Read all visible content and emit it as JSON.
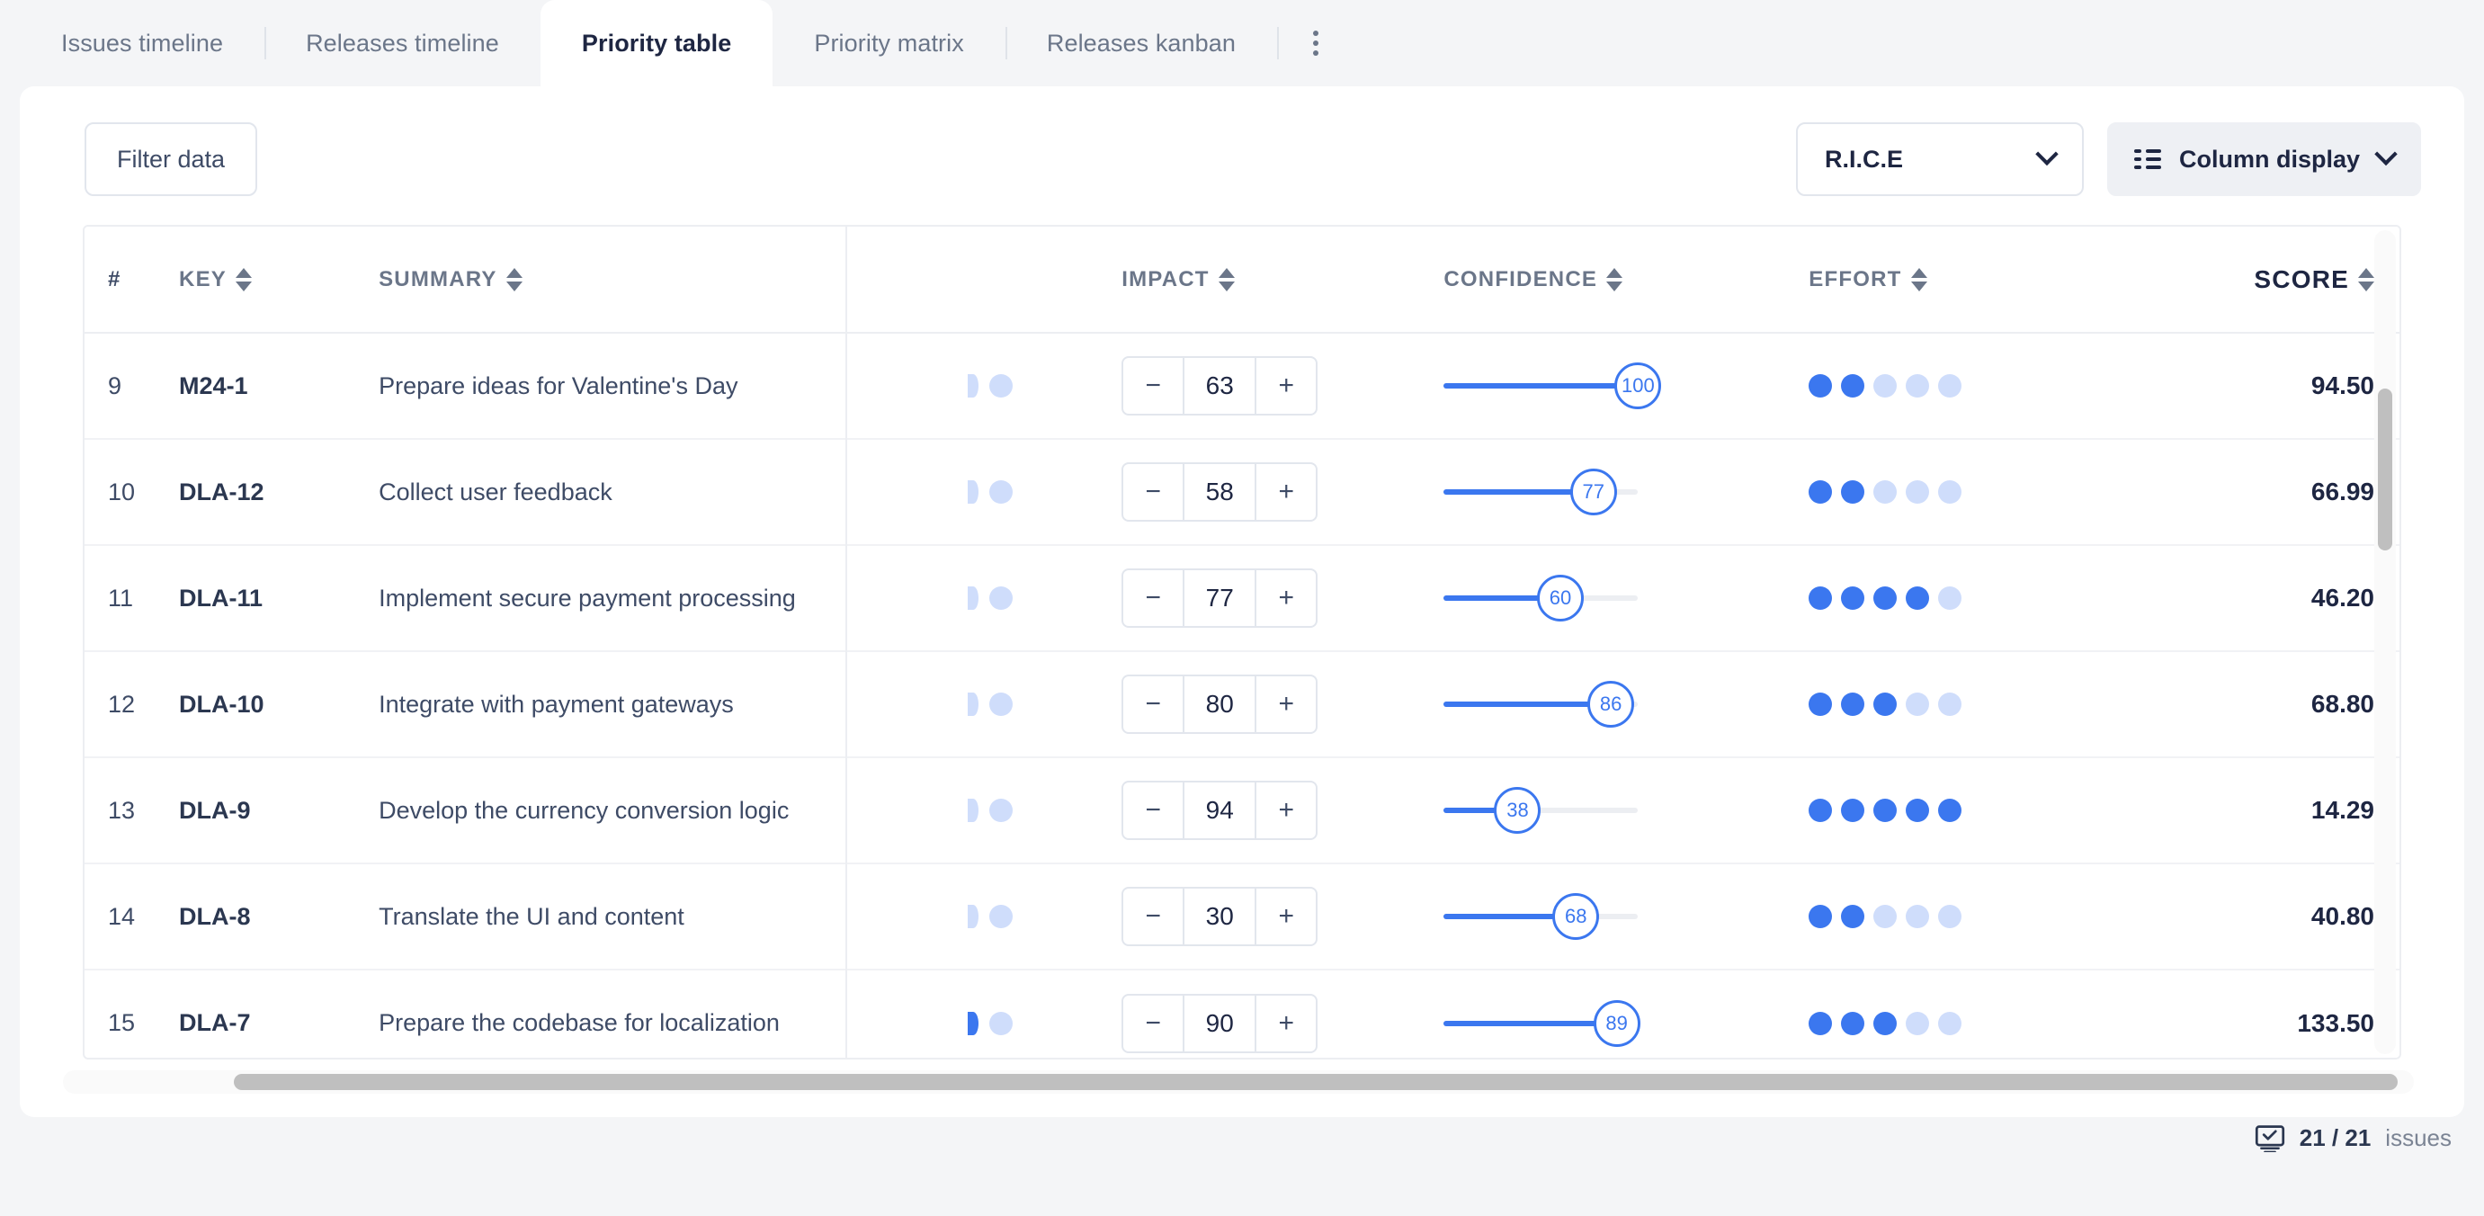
{
  "tabs": [
    {
      "label": "Issues timeline",
      "active": false
    },
    {
      "label": "Releases timeline",
      "active": false
    },
    {
      "label": "Priority table",
      "active": true
    },
    {
      "label": "Priority matrix",
      "active": false
    },
    {
      "label": "Releases kanban",
      "active": false
    }
  ],
  "tabs_more_icon": "kebab-menu-icon",
  "toolbar": {
    "filter_label": "Filter data",
    "framework_value": "R.I.C.E",
    "column_display_label": "Column display",
    "column_display_icon": "column-list-icon",
    "chevron_icon": "chevron-down-icon"
  },
  "table": {
    "columns": [
      {
        "key": "index",
        "label": "#",
        "sortable": false
      },
      {
        "key": "key",
        "label": "KEY",
        "sortable": true
      },
      {
        "key": "summary",
        "label": "SUMMARY",
        "sortable": true
      },
      {
        "key": "reach",
        "label": "",
        "sortable": false
      },
      {
        "key": "impact",
        "label": "IMPACT",
        "sortable": true
      },
      {
        "key": "confidence",
        "label": "CONFIDENCE",
        "sortable": true
      },
      {
        "key": "effort",
        "label": "EFFORT",
        "sortable": true
      },
      {
        "key": "score",
        "label": "SCORE",
        "sortable": true
      }
    ],
    "rows": [
      {
        "index": "9",
        "key": "M24-1",
        "summary": "Prepare ideas for Valentine's Day",
        "reach_filled": 0,
        "impact": "63",
        "confidence": "100",
        "confidence_pct": 100,
        "effort_filled": 2,
        "score": "94.50"
      },
      {
        "index": "10",
        "key": "DLA-12",
        "summary": "Collect user feedback",
        "reach_filled": 0,
        "impact": "58",
        "confidence": "77",
        "confidence_pct": 77,
        "effort_filled": 2,
        "score": "66.99"
      },
      {
        "index": "11",
        "key": "DLA-11",
        "summary": "Implement secure payment processing",
        "reach_filled": 0,
        "impact": "77",
        "confidence": "60",
        "confidence_pct": 60,
        "effort_filled": 4,
        "score": "46.20"
      },
      {
        "index": "12",
        "key": "DLA-10",
        "summary": "Integrate with payment gateways",
        "reach_filled": 0,
        "impact": "80",
        "confidence": "86",
        "confidence_pct": 86,
        "effort_filled": 3,
        "score": "68.80"
      },
      {
        "index": "13",
        "key": "DLA-9",
        "summary": "Develop the currency conversion logic",
        "reach_filled": 0,
        "impact": "94",
        "confidence": "38",
        "confidence_pct": 38,
        "effort_filled": 5,
        "score": "14.29"
      },
      {
        "index": "14",
        "key": "DLA-8",
        "summary": "Translate the UI and content",
        "reach_filled": 0,
        "impact": "30",
        "confidence": "68",
        "confidence_pct": 68,
        "effort_filled": 2,
        "score": "40.80"
      },
      {
        "index": "15",
        "key": "DLA-7",
        "summary": "Prepare the codebase for localization",
        "reach_filled": 1,
        "impact": "90",
        "confidence": "89",
        "confidence_pct": 89,
        "effort_filled": 3,
        "score": "133.50"
      }
    ],
    "stepper_minus_label": "−",
    "stepper_plus_label": "+",
    "effort_dot_count": 5
  },
  "footer": {
    "icon": "issues-count-icon",
    "count": "21 / 21",
    "label": "issues"
  },
  "colors": {
    "accent": "#3b77ef",
    "accent_light": "#cfddfb",
    "text_dark": "#1e2642",
    "text_muted": "#6b7689",
    "page_bg": "#f4f5f7"
  }
}
